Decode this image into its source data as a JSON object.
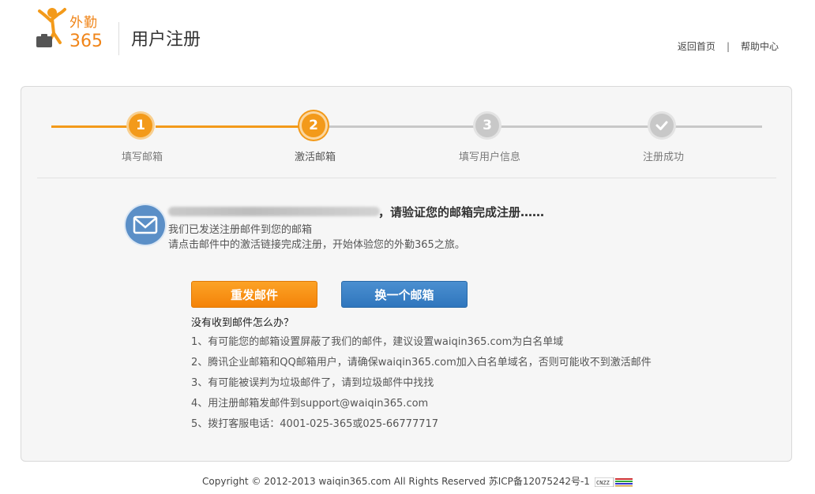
{
  "header": {
    "logo_text_top": "外勤",
    "logo_text_num": "365",
    "title": "用户注册",
    "links": [
      "返回首页",
      "帮助中心"
    ],
    "separator": "|"
  },
  "steps": [
    {
      "number": "1",
      "label": "填写邮箱",
      "state": "done"
    },
    {
      "number": "2",
      "label": "激活邮箱",
      "state": "active"
    },
    {
      "number": "3",
      "label": "填写用户信息",
      "state": "todo"
    },
    {
      "number": "",
      "label": "注册成功",
      "state": "todo",
      "icon": "check-icon"
    }
  ],
  "message": {
    "heading_suffix": "，请验证您的邮箱完成注册……",
    "line1": "我们已发送注册邮件到您的邮箱",
    "line2": "请点击邮件中的激活链接完成注册，开始体验您的外勤365之旅。"
  },
  "buttons": {
    "resend": "重发邮件",
    "change": "换一个邮箱"
  },
  "help": {
    "title": "没有收到邮件怎么办？",
    "items": [
      "1、有可能您的邮箱设置屏蔽了我们的邮件，建议设置waiqin365.com为白名单域",
      "2、腾讯企业邮箱和QQ邮箱用户，请确保waiqin365.com加入白名单域名，否则可能收不到激活邮件",
      "3、有可能被误判为垃圾邮件了，请到垃圾邮件中找找",
      "4、用注册邮箱发邮件到support@waiqin365.com",
      "5、拨打客服电话：4001-025-365或025-66777717"
    ]
  },
  "footer": {
    "text": "Copyright © 2012-2013 waiqin365.com All Rights Reserved 苏ICP备12075242号-1",
    "badge": "CNZZ"
  },
  "colors": {
    "accent_orange": "#f39a1a",
    "accent_blue": "#2f76bd",
    "inactive_gray": "#c8c8c8"
  }
}
